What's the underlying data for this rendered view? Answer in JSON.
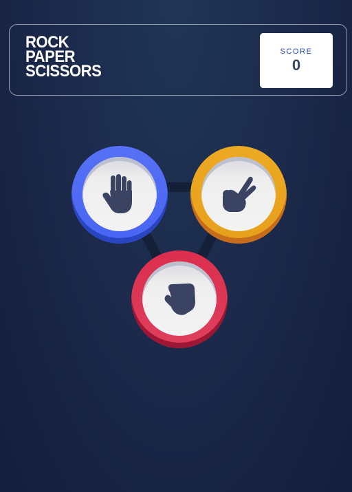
{
  "header": {
    "title_lines": [
      "ROCK",
      "PAPER",
      "SCISSORS"
    ],
    "score_label": "SCORE",
    "score_value": "0"
  },
  "choices": [
    {
      "name": "paper",
      "color": "#4865f4",
      "icon": "paper-hand-icon"
    },
    {
      "name": "scissors",
      "color": "#eca922",
      "icon": "scissors-hand-icon"
    },
    {
      "name": "rock",
      "color": "#dc2e4e",
      "icon": "rock-fist-icon"
    }
  ],
  "colors": {
    "background": "#1f3756",
    "icon": "#3b4363",
    "score_label": "#2a46c0"
  }
}
